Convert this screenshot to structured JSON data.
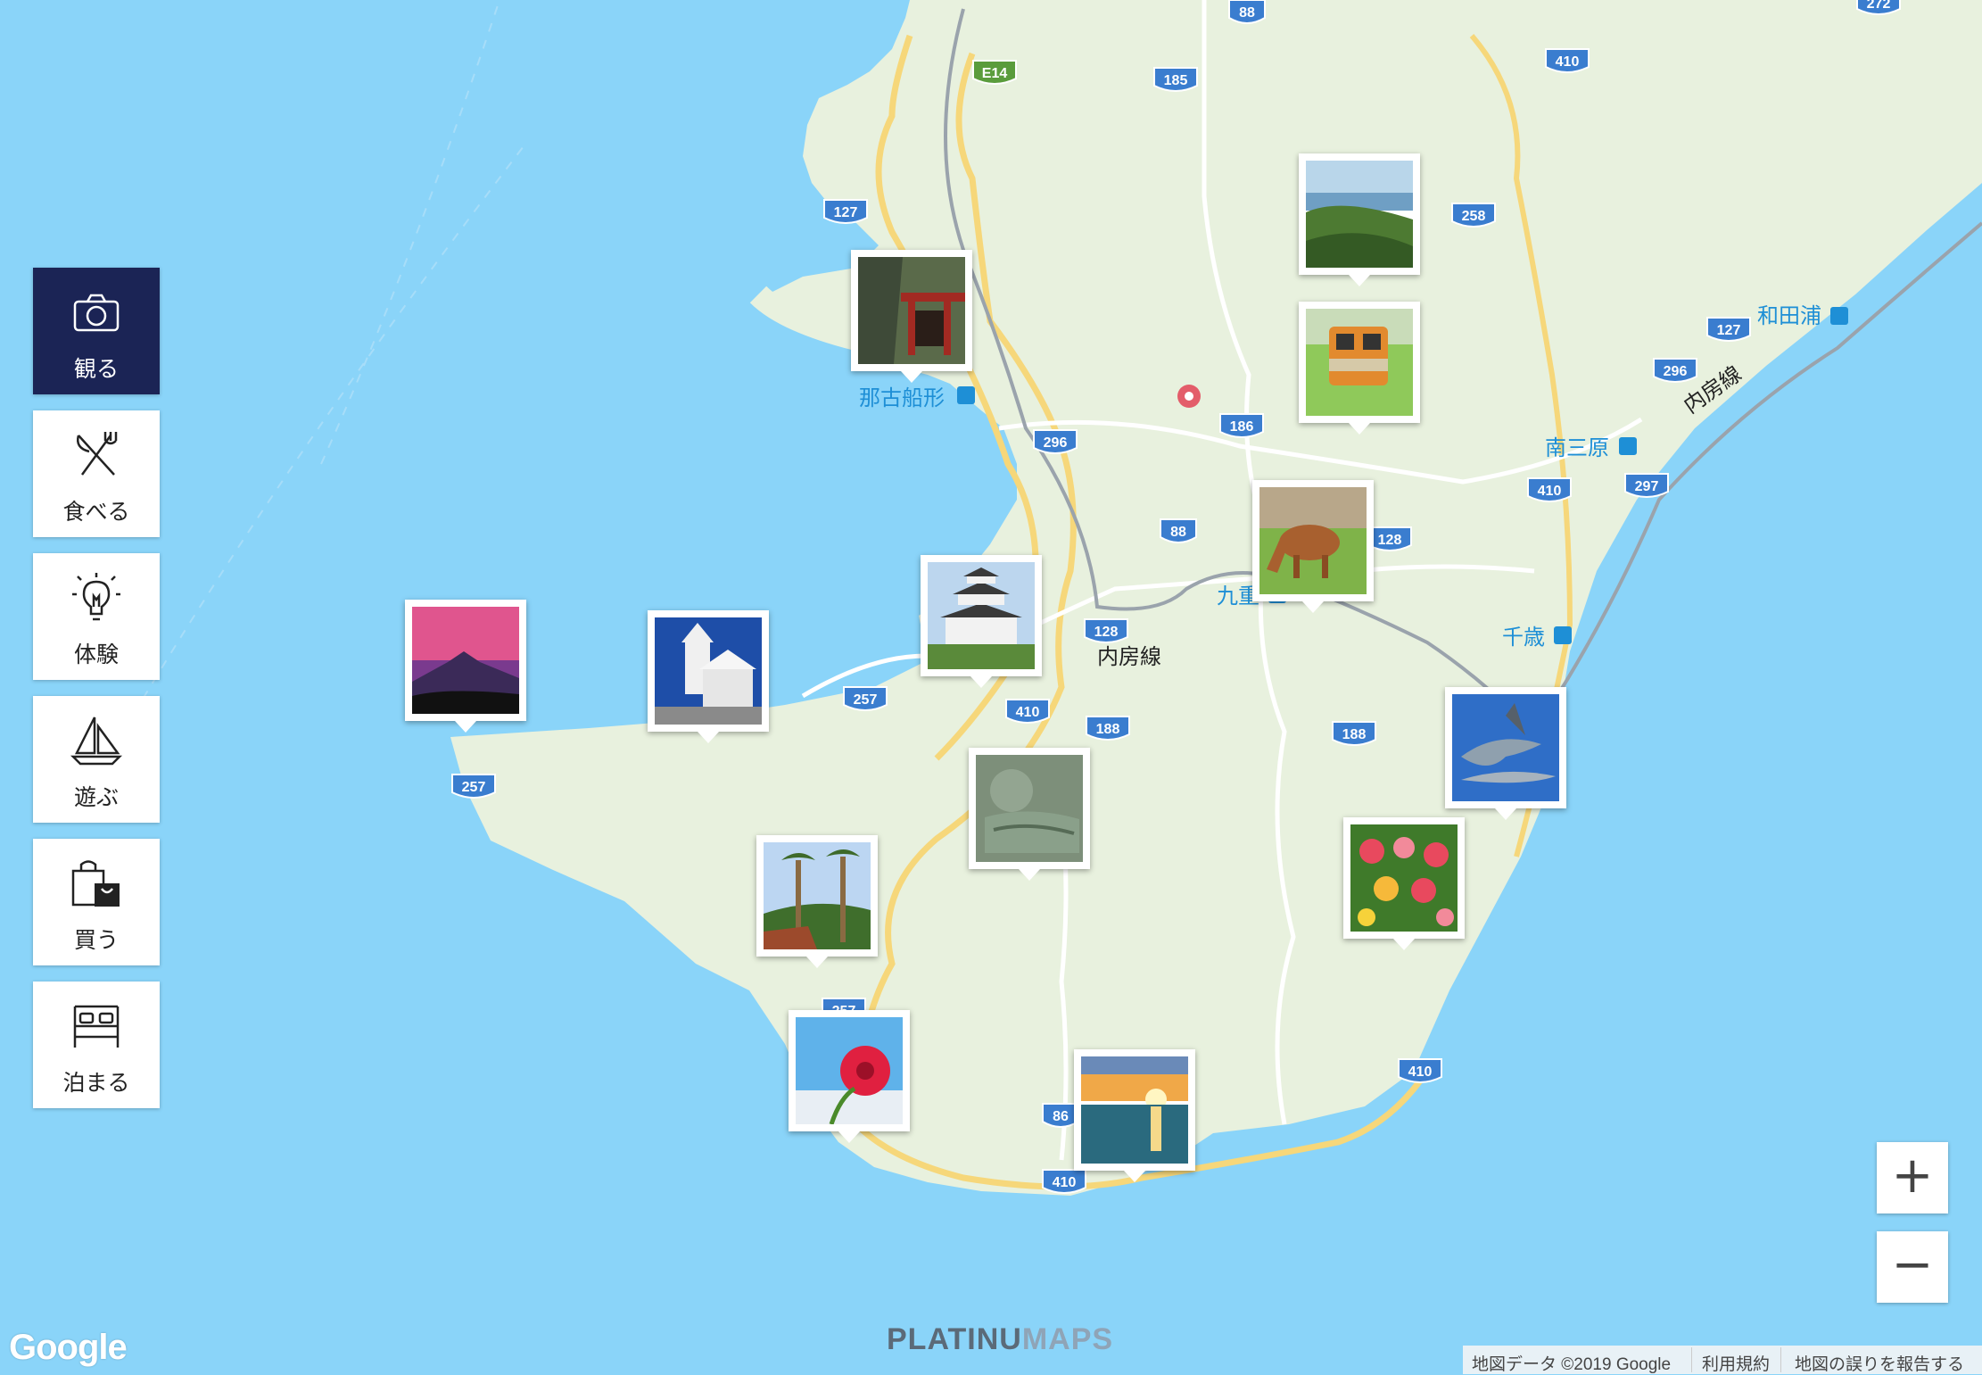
{
  "sidebar": {
    "categories": [
      {
        "label": "観る",
        "icon": "camera-icon",
        "active": true
      },
      {
        "label": "食べる",
        "icon": "fork-knife-icon",
        "active": false
      },
      {
        "label": "体験",
        "icon": "lightbulb-icon",
        "active": false
      },
      {
        "label": "遊ぶ",
        "icon": "sailboat-icon",
        "active": false
      },
      {
        "label": "買う",
        "icon": "shopping-bag-icon",
        "active": false
      },
      {
        "label": "泊まる",
        "icon": "bed-icon",
        "active": false
      }
    ],
    "active_color": "#1b2455"
  },
  "map": {
    "stations": [
      "那古船形",
      "和田浦",
      "南三原",
      "九重",
      "千歳"
    ],
    "rail_line": "内房線",
    "route_shields": [
      "88",
      "272",
      "E14",
      "185",
      "410",
      "127",
      "258",
      "296",
      "186",
      "127",
      "296",
      "410",
      "297",
      "88",
      "128",
      "128",
      "257",
      "410",
      "188",
      "188",
      "257",
      "257",
      "86",
      "410",
      "410"
    ],
    "pins": [
      {
        "icon": "coastal-forest-photo-icon"
      },
      {
        "icon": "shrine-cliff-photo-icon"
      },
      {
        "icon": "train-photo-icon"
      },
      {
        "icon": "cow-photo-icon"
      },
      {
        "icon": "castle-photo-icon"
      },
      {
        "icon": "church-photo-icon"
      },
      {
        "icon": "mount-fuji-sunset-photo-icon"
      },
      {
        "icon": "dolphin-photo-icon"
      },
      {
        "icon": "reclining-buddha-photo-icon"
      },
      {
        "icon": "palm-trees-photo-icon"
      },
      {
        "icon": "flower-field-photo-icon"
      },
      {
        "icon": "red-flower-photo-icon"
      },
      {
        "icon": "sunset-beach-photo-icon"
      }
    ],
    "colors": {
      "sea": "#8ad4f9",
      "land": "#e8f1de",
      "road_major": "#f6d77a",
      "road": "#ffffff",
      "shield": "#3a7dcf",
      "shield_green": "#5a9c3c",
      "station_text": "#1e8fd6"
    }
  },
  "zoom": {
    "in_label": "+",
    "out_label": "−"
  },
  "footer": {
    "google": "Google",
    "brand_a": "PLATINU",
    "brand_b": "MAPS",
    "copyright": "地図データ ©2019 Google",
    "terms": "利用規約",
    "report": "地図の誤りを報告する"
  }
}
